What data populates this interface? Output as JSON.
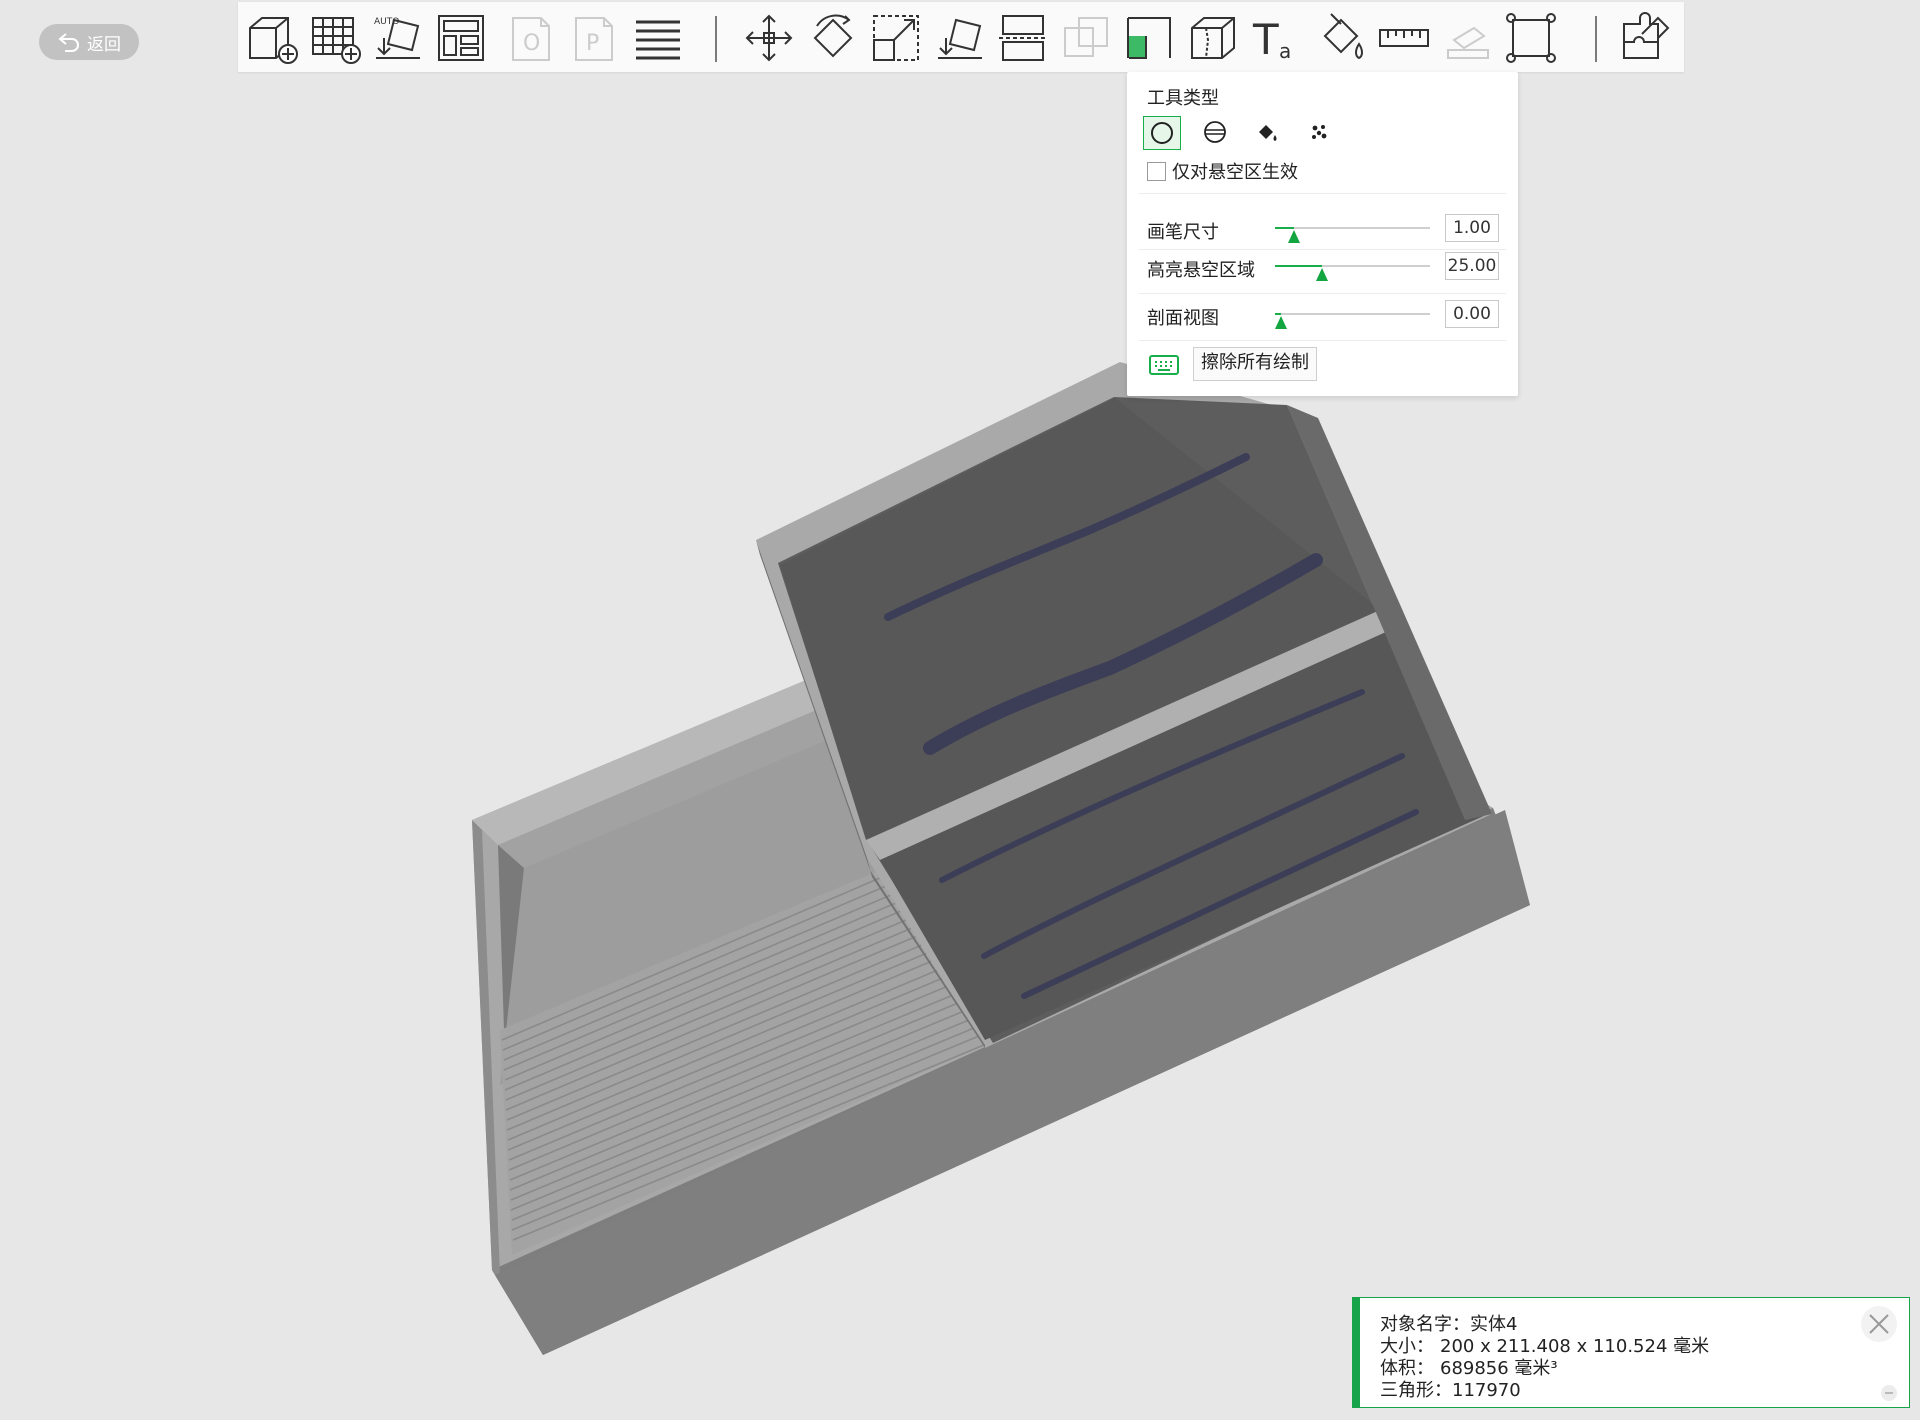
{
  "header": {
    "back_label": "返回"
  },
  "toolbar": {
    "items": [
      {
        "name": "add-box-icon",
        "enabled": true
      },
      {
        "name": "add-grid-icon",
        "enabled": true
      },
      {
        "name": "auto-place-icon",
        "enabled": true,
        "badge": "AUTO"
      },
      {
        "name": "arrange-layout-icon",
        "enabled": true
      },
      {
        "name": "plate-o-icon",
        "enabled": false,
        "badge": "O"
      },
      {
        "name": "plate-p-icon",
        "enabled": false,
        "badge": "P"
      },
      {
        "name": "layers-icon",
        "enabled": true
      },
      {
        "name": "move-icon",
        "enabled": true
      },
      {
        "name": "rotate-icon",
        "enabled": true
      },
      {
        "name": "scale-icon",
        "enabled": true
      },
      {
        "name": "lay-on-face-icon",
        "enabled": true
      },
      {
        "name": "cut-icon",
        "enabled": true
      },
      {
        "name": "boolean-icon",
        "enabled": false
      },
      {
        "name": "support-paint-icon",
        "enabled": true,
        "active": true
      },
      {
        "name": "seam-paint-icon",
        "enabled": true
      },
      {
        "name": "text-icon",
        "enabled": true
      },
      {
        "name": "color-paint-icon",
        "enabled": true
      },
      {
        "name": "measure-icon",
        "enabled": true
      },
      {
        "name": "assemble-icon",
        "enabled": false
      },
      {
        "name": "fit-view-icon",
        "enabled": true
      },
      {
        "name": "split-parts-icon",
        "enabled": true
      }
    ]
  },
  "paint_panel": {
    "tool_type_label": "工具类型",
    "tool_types": [
      {
        "name": "circle-brush-icon",
        "active": true
      },
      {
        "name": "sphere-brush-icon",
        "active": false
      },
      {
        "name": "fill-bucket-icon",
        "active": false
      },
      {
        "name": "gap-fill-icon",
        "active": false
      }
    ],
    "overhang_only_label": "仅对悬空区生效",
    "overhang_only_checked": false,
    "brush_size": {
      "label": "画笔尺寸",
      "value": "1.00",
      "fraction": 0.12
    },
    "highlight_overhang": {
      "label": "高亮悬空区域",
      "value": "25.00",
      "fraction": 0.3
    },
    "section_view": {
      "label": "剖面视图",
      "value": "0.00",
      "fraction": 0.04
    },
    "erase_all_label": "擦除所有绘制"
  },
  "object_info": {
    "name_label": "对象名字：",
    "name_value": "实体4",
    "size_label": "大小：",
    "size_value": "200 x 211.408 x 110.524 毫米",
    "volume_label": "体积：",
    "volume_value": "689856 毫米³",
    "triangles_label": "三角形：",
    "triangles_value": "117970"
  },
  "colors": {
    "accent": "#1aae4a",
    "model_gray": "#8a8a8a",
    "paint_stroke": "#3a3a55",
    "background": "#e7e7e7"
  }
}
